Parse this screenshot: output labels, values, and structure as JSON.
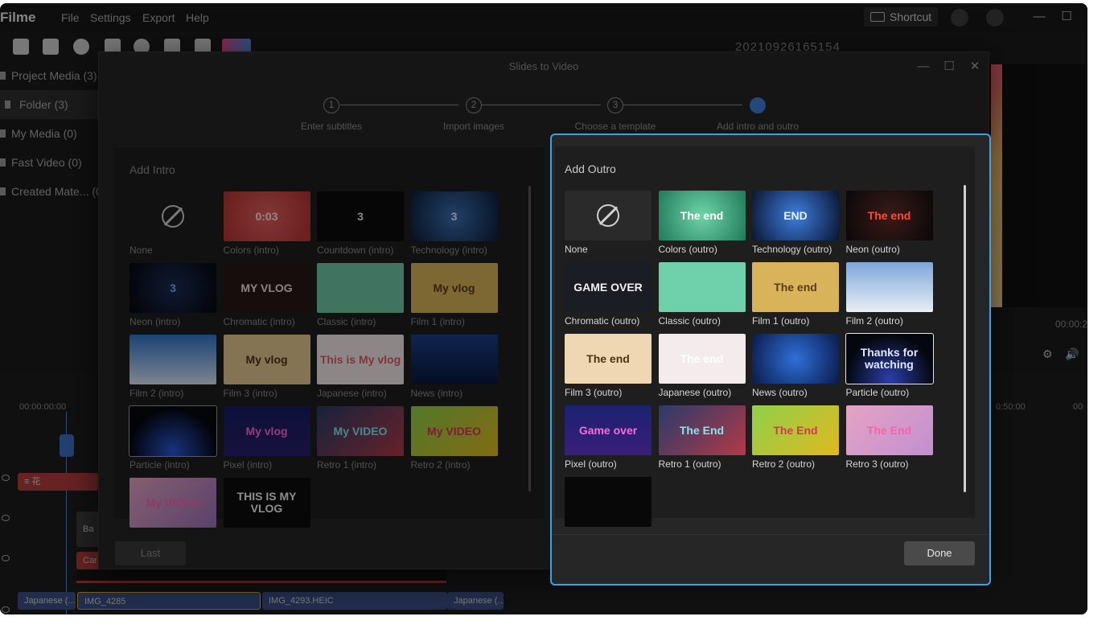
{
  "app": {
    "name": "Filme",
    "menu": [
      "File",
      "Settings",
      "Export",
      "Help"
    ],
    "shortcut_label": "Shortcut",
    "recording_title": "20210926165154",
    "preview_time": "00:00:2",
    "markers": [
      "0:50:00",
      "00"
    ]
  },
  "sidebar": {
    "items": [
      {
        "label": "Project Media (3)"
      },
      {
        "label": "Folder (3)"
      },
      {
        "label": "My Media (0)"
      },
      {
        "label": "Fast Video (0)"
      },
      {
        "label": "Created Mate... (0"
      }
    ]
  },
  "timeline": {
    "start_time": "00:00:00:00",
    "track_labels": [
      "Ba",
      "Car"
    ],
    "clips": [
      "Japanese (...",
      "IMG_4285",
      "IMG_4293.HEIC",
      "Japanese (..."
    ]
  },
  "modal": {
    "title": "Slides to Video",
    "steps": [
      {
        "number": "1",
        "label": "Enter subtitles"
      },
      {
        "number": "2",
        "label": "Import images"
      },
      {
        "number": "3",
        "label": "Choose a template"
      },
      {
        "number": "",
        "label": "Add intro and outro"
      }
    ],
    "intro": {
      "heading": "Add Intro",
      "tiles": [
        {
          "label": "None",
          "text": "",
          "bg": "#1e1e1e",
          "fg": "#ddd",
          "none": true
        },
        {
          "label": "Colors (intro)",
          "text": "0:03",
          "bg": "radial-gradient(circle,#e06060,#b43232)",
          "fg": "#ffe3e3"
        },
        {
          "label": "Countdown (intro)",
          "text": "3",
          "bg": "#0b0b0b",
          "fg": "#e8e8e8"
        },
        {
          "label": "Technology (intro)",
          "text": "3",
          "bg": "radial-gradient(circle,#3a6fb0,#0c1d3b)",
          "fg": "#e0eeff"
        },
        {
          "label": "Neon (intro)",
          "text": "3",
          "bg": "radial-gradient(circle,#1b2c55,#06070e)",
          "fg": "#7fa7ff"
        },
        {
          "label": "Chromatic (intro)",
          "text": "MY VLOG",
          "bg": "#2a1717",
          "fg": "#f0e0e0"
        },
        {
          "label": "Classic (intro)",
          "text": "",
          "bg": "#6fc7a6",
          "fg": "#fff"
        },
        {
          "label": "Film 1 (intro)",
          "text": "My vlog",
          "bg": "#d8b35a",
          "fg": "#5a3b14"
        },
        {
          "label": "Film 2 (intro)",
          "text": "",
          "bg": "linear-gradient(#2d73c7,#d9e6f7)",
          "fg": "#fff"
        },
        {
          "label": "Film 3 (intro)",
          "text": "My vlog",
          "bg": "#e6c892",
          "fg": "#4c3216"
        },
        {
          "label": "Japanese (intro)",
          "text": "This is My vlog",
          "bg": "#f1e7e7",
          "fg": "#e25a64"
        },
        {
          "label": "News (intro)",
          "text": "",
          "bg": "linear-gradient(#1a3e8a,#0b1838)",
          "fg": "#fff"
        },
        {
          "label": "Particle (intro)",
          "text": "",
          "bg": "radial-gradient(circle at 50% 90%,#2b57d6,#05070f 70%)",
          "fg": "#fff"
        },
        {
          "label": "Pixel (intro)",
          "text": "My vlog",
          "bg": "linear-gradient(#141e66,#2a1e6a)",
          "fg": "#ff6ad5"
        },
        {
          "label": "Retro 1 (intro)",
          "text": "My VIDEO",
          "bg": "linear-gradient(135deg,#2a3b6a,#b23a48)",
          "fg": "#7fe8f0"
        },
        {
          "label": "Retro 2 (intro)",
          "text": "My VIDEO",
          "bg": "linear-gradient(135deg,#8fd04a,#e0b820)",
          "fg": "#d8345a"
        },
        {
          "label": "",
          "text": "My VIDEO",
          "bg": "linear-gradient(135deg,#e4a3c4,#9c72b8)",
          "fg": "#ff5fa8"
        },
        {
          "label": "",
          "text": "THIS IS MY VLOG",
          "bg": "#0d0d0d",
          "fg": "#f2f2f2"
        }
      ]
    },
    "outro": {
      "heading": "Add Outro",
      "tiles": [
        {
          "label": "None",
          "text": "",
          "bg": "#2a2a2a",
          "fg": "#ddd",
          "none": true
        },
        {
          "label": "Colors (outro)",
          "text": "The end",
          "bg": "radial-gradient(circle,#6fd4a8,#1f7a5a)",
          "fg": "#ffffff"
        },
        {
          "label": "Technology (outro)",
          "text": "END",
          "bg": "radial-gradient(circle,#3d7ee0,#0a1530)",
          "fg": "#e6f2ff"
        },
        {
          "label": "Neon (outro)",
          "text": "The end",
          "bg": "radial-gradient(circle,#3a1a18,#0a0808)",
          "fg": "#ff4a3a"
        },
        {
          "label": "Chromatic (outro)",
          "text": "GAME OVER",
          "bg": "#1a1d24",
          "fg": "#f0f0f0"
        },
        {
          "label": "Classic (outro)",
          "text": "",
          "bg": "#6fd1ac",
          "fg": "#fff"
        },
        {
          "label": "Film 1 (outro)",
          "text": "The end",
          "bg": "#d8b35a",
          "fg": "#5a3b14"
        },
        {
          "label": "Film 2 (outro)",
          "text": "",
          "bg": "linear-gradient(#7ea7d8,#e8eef5)",
          "fg": "#fff"
        },
        {
          "label": "Film 3 (outro)",
          "text": "The end",
          "bg": "#efd7b4",
          "fg": "#4c3216"
        },
        {
          "label": "Japanese (outro)",
          "text": "The end",
          "bg": "#f4ecec",
          "fg": "#ffffff"
        },
        {
          "label": "News (outro)",
          "text": "",
          "bg": "radial-gradient(circle,#2f6fd8,#0a1a4a)",
          "fg": "#fff"
        },
        {
          "label": "Particle (outro)",
          "text": "Thanks for watching",
          "bg": "radial-gradient(circle at 50% 90%,#2b3ea8,#05070f 70%)",
          "fg": "#dfe6ff"
        },
        {
          "label": "Pixel (outro)",
          "text": "Game over",
          "bg": "linear-gradient(#1a2270,#3a1e7a)",
          "fg": "#ff6ad5"
        },
        {
          "label": "Retro 1 (outro)",
          "text": "The End",
          "bg": "linear-gradient(135deg,#2a3b6a,#b23a48)",
          "fg": "#7fe8f0"
        },
        {
          "label": "Retro 2 (outro)",
          "text": "The End",
          "bg": "linear-gradient(135deg,#8fd04a,#e0b820)",
          "fg": "#d8345a"
        },
        {
          "label": "Retro 3 (outro)",
          "text": "The End",
          "bg": "linear-gradient(135deg,#e4a3c4,#c28fd0)",
          "fg": "#ff5fa8"
        },
        {
          "label": "",
          "text": "",
          "bg": "#080808",
          "fg": "#fff"
        }
      ]
    },
    "last_label": "Last",
    "done_label": "Done"
  }
}
